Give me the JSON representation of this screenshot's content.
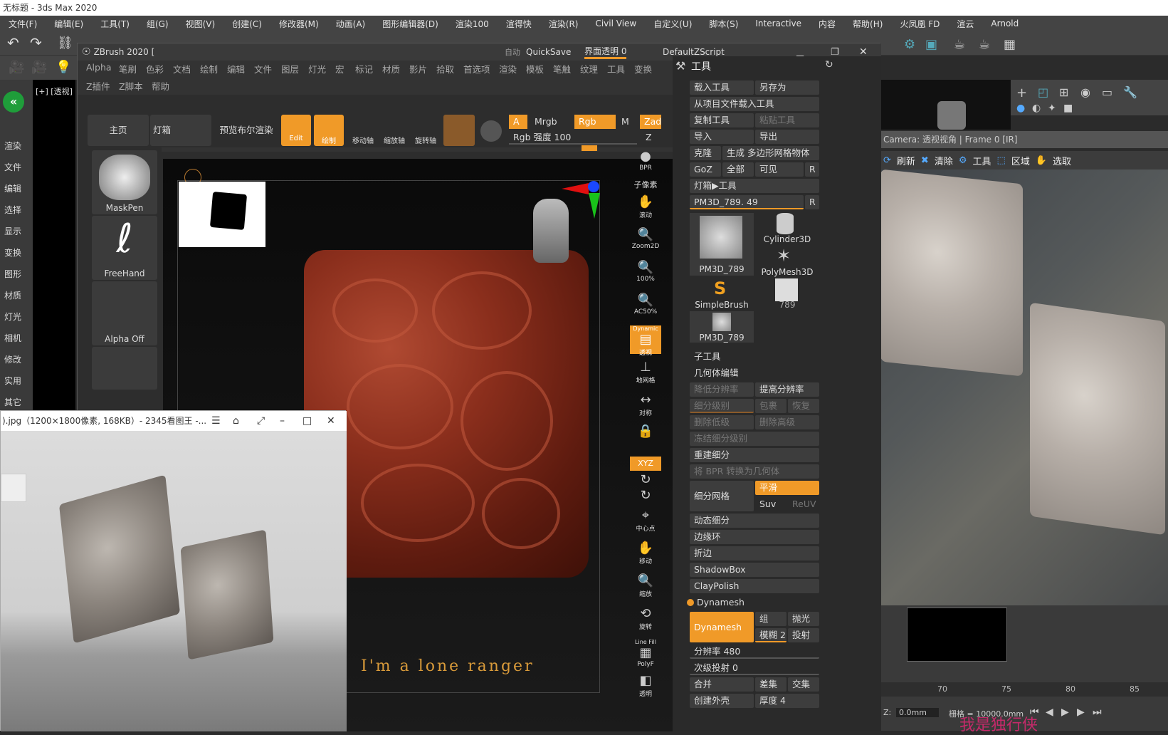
{
  "max": {
    "title": "无标题 - 3ds Max 2020",
    "menu": [
      "文件(F)",
      "编辑(E)",
      "工具(T)",
      "组(G)",
      "视图(V)",
      "创建(C)",
      "修改器(M)",
      "动画(A)",
      "图形编辑器(D)",
      "渲染100",
      "渲得快",
      "渲染(R)",
      "Civil View",
      "自定义(U)",
      "脚本(S)",
      "Interactive",
      "内容",
      "帮助(H)",
      "火凤凰 FD",
      "渲云",
      "Arnold"
    ],
    "leftnav": [
      "渲染",
      "文件",
      "编辑",
      "选择",
      "显示",
      "变换",
      "图形",
      "材质",
      "灯光",
      "相机",
      "修改",
      "实用",
      "其它"
    ],
    "viewport_label": "[+] [透视]",
    "camera_bar": "Camera: 透视视角 | Frame 0 [IR]",
    "cam_tools": [
      "刷新",
      "清除",
      "工具",
      "区域",
      "选取"
    ],
    "timeline_ticks": [
      "70",
      "75",
      "80",
      "85"
    ],
    "status": {
      "z_label": "Z:",
      "z_value": "0.0mm",
      "grid": "栅格 = 10000.0mm"
    }
  },
  "zbrush": {
    "title": "ZBrush 2020 [",
    "title_right": {
      "auto": "自动",
      "quicksave": "QuickSave",
      "ui_trans": "界面透明 0",
      "script": "DefaultZScript"
    },
    "menu_row1": [
      "Alpha",
      "笔刷",
      "色彩",
      "文档",
      "绘制",
      "编辑",
      "文件",
      "图层",
      "灯光",
      "宏",
      "标记",
      "材质",
      "影片",
      "拾取",
      "首选项",
      "渲染",
      "模板",
      "笔触",
      "纹理",
      "工具",
      "变换"
    ],
    "menu_row2": [
      "Z插件",
      "Z脚本",
      "帮助"
    ],
    "shelf": {
      "home": "主页",
      "lightbox": "灯箱",
      "bpr": "预览布尔渲染",
      "edit": "Edit",
      "draw": "绘制",
      "move": "移动轴",
      "scale": "缩放轴",
      "rotate": "旋转轴"
    },
    "color": {
      "a": "A",
      "mrgb": "Mrgb",
      "rgb": "Rgb",
      "m": "M",
      "zadd": "Zadd",
      "rgb_intensity": "Rgb 强度 100",
      "z_intensity": "Z 强"
    },
    "brushes": [
      "MaskPen",
      "FreeHand",
      "Alpha Off"
    ],
    "canvas_text": "I'm a lone ranger",
    "right_icons": [
      "BPR",
      "子像素",
      "滚动",
      "Zoom2D",
      "100%",
      "AC50%",
      "透视",
      "地网格",
      "对称",
      "Dynamic",
      "XYZ",
      "中心点",
      "移动",
      "缩放",
      "旋转",
      "Line Fill",
      "PolyF",
      "透明"
    ],
    "tool": {
      "header": "工具",
      "load": "载入工具",
      "saveas": "另存为",
      "load_project": "从项目文件载入工具",
      "copy": "复制工具",
      "paste": "粘贴工具",
      "import": "导入",
      "export": "导出",
      "clone": "克隆",
      "make_polymesh": "生成 多边形网格物体",
      "goz": "GoZ",
      "all": "全部",
      "visible": "可见",
      "r": "R",
      "lightbox_tool": "灯箱▶工具",
      "current": "PM3D_789. 49",
      "thumbs": [
        "PM3D_789",
        "Cylinder3D",
        "PolyMesh3D",
        "SimpleBrush",
        "789",
        "PM3D_789"
      ],
      "subtool": "子工具",
      "geometry": "几何体编辑",
      "lower_res": "降低分辨率",
      "higher_res": "提高分辨率",
      "sdiv": "细分级别",
      "del": "包裹",
      "restore": "恢复",
      "del_lower": "删除低级",
      "del_higher": "删除高级",
      "freeze": "冻结细分级别",
      "reconstruct": "重建细分",
      "bpr_to_geo": "将 BPR 转换为几何体",
      "divide": "细分网格",
      "smooth": "平滑",
      "suv": "Suv",
      "reuv": "ReUV",
      "dynamic_sub": "动态细分",
      "edgeloop": "边缘环",
      "crease": "折边",
      "shadowbox": "ShadowBox",
      "claypolish": "ClayPolish",
      "dynamesh_section": "Dynamesh",
      "dynamesh_btn": "Dynamesh",
      "group": "组",
      "polish": "抛光",
      "blur": "模糊 2",
      "project": "投射",
      "resolution": "分辨率 480",
      "subproject": "次级投射 0",
      "add": "合并",
      "sub": "差集",
      "and": "交集",
      "create_shell": "创建外壳",
      "thickness": "厚度 4"
    }
  },
  "viewer": {
    "title": ").jpg（1200×1800像素, 168KB）- 2345看图王 -..."
  },
  "watermark": "我是独行侠"
}
